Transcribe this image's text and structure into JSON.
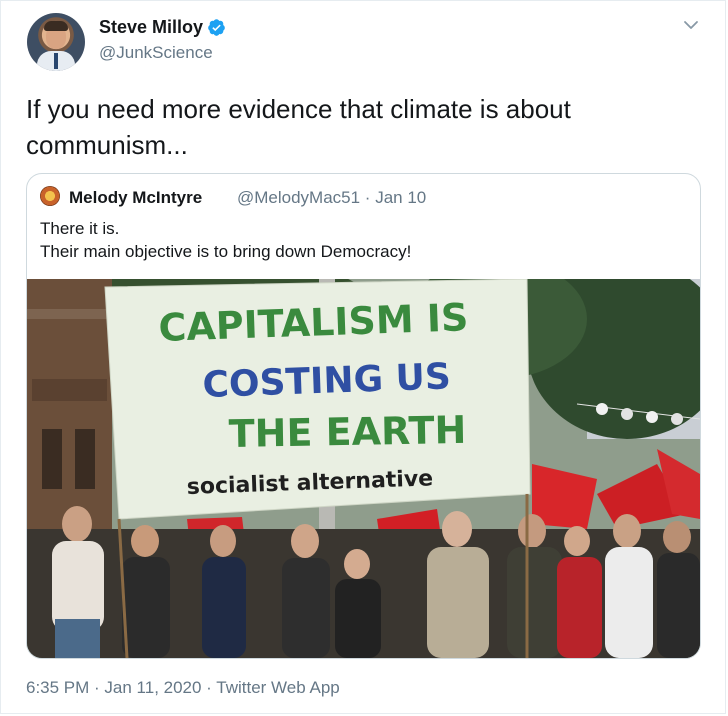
{
  "author": {
    "name": "Steve Milloy",
    "handle": "@JunkScience",
    "verified": true
  },
  "tweet": {
    "text_line1": "If you need more evidence that climate is about",
    "text_line2": "communism..."
  },
  "quoted_tweet": {
    "name": "Melody McIntyre",
    "handle_date": "@MelodyMac51 · Jan 10",
    "line1": "There it is.",
    "line2": "Their main objective is to bring down Democracy!",
    "image": {
      "banner_line1": "CAPITALISM IS",
      "banner_line2": "COSTING US",
      "banner_line3": "THE EARTH",
      "banner_line4": "socialist alternative"
    }
  },
  "footer": {
    "timestamp_source": "6:35 PM · Jan 11, 2020 · Twitter Web App"
  },
  "colors": {
    "accent": "#1da1f2",
    "secondary_text": "#657786",
    "border": "#cfd9de",
    "banner_green": "#3a8a3e",
    "banner_blue": "#2f4fa3"
  },
  "icons": {
    "verified": "verified-badge-icon",
    "menu": "chevron-down-icon"
  }
}
